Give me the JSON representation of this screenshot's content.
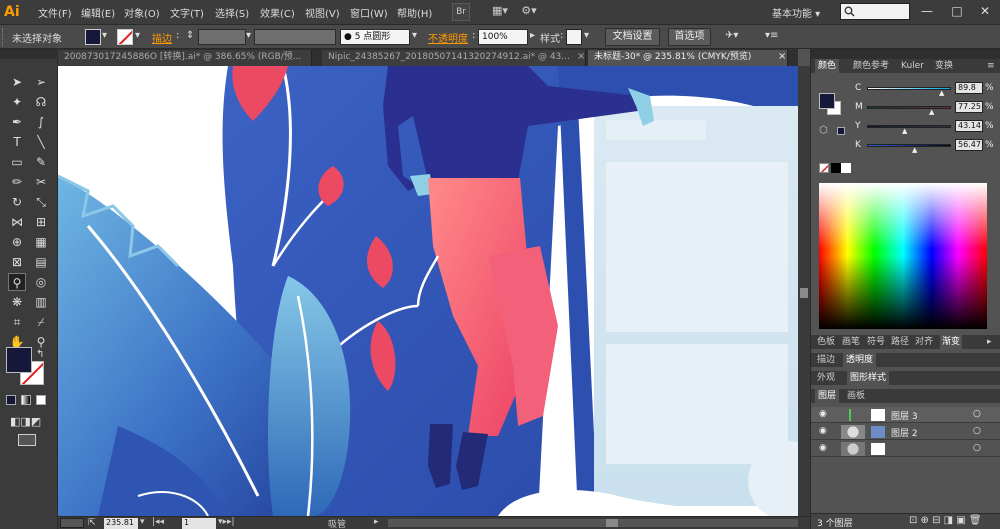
{
  "app": {
    "logo": "Ai",
    "workspace": "基本功能",
    "minimize": "—",
    "restore": "□",
    "close": "✕"
  },
  "menus": [
    "文件(F)",
    "编辑(E)",
    "对象(O)",
    "文字(T)",
    "选择(S)",
    "效果(C)",
    "视图(V)",
    "窗口(W)",
    "帮助(H)"
  ],
  "menubar_icons": [
    "Br",
    "▦▾",
    "⚙▾"
  ],
  "control": {
    "selection": "未选择对象",
    "stroke_label": "描边",
    "brush": "● 5 点圆形",
    "opacity_label": "不透明度",
    "opacity_value": "100%",
    "style_label": "样式",
    "doc_setup": "文档设置",
    "prefs": "首选项"
  },
  "tabs": [
    "200873017245886O [转换].ai* @ 386.65% (RGB/预...",
    "Nipic_24385267_20180507141320274912.ai* @ 43...",
    "未标题-30* @ 235.81% (CMYK/预览)"
  ],
  "tab_close": "×",
  "status": {
    "zoom": "235.81",
    "page": "1",
    "tool": "吸管"
  },
  "color_panel": {
    "tabs": [
      "颜色",
      "颜色参考",
      "Kuler",
      "变换"
    ],
    "channels": [
      {
        "name": "C",
        "value": "89.8",
        "pos": 0.9
      },
      {
        "name": "M",
        "value": "77.25",
        "pos": 0.77
      },
      {
        "name": "Y",
        "value": "43.14",
        "pos": 0.43
      },
      {
        "name": "K",
        "value": "56.47",
        "pos": 0.56
      }
    ],
    "fill_color": "#151838"
  },
  "panel_tabs_1": [
    "色板",
    "画笔",
    "符号",
    "路径",
    "对齐",
    "渐变"
  ],
  "panel_tabs_2": [
    "描边",
    "透明度"
  ],
  "panel_tabs_3": [
    "外观",
    "图形样式"
  ],
  "panel_tabs_4": [
    "图层",
    "画板"
  ],
  "layers": [
    {
      "name": "图层 3",
      "color": "#4fc94f"
    },
    {
      "name": "图层 2",
      "color": "#ff3333"
    },
    {
      "name": "",
      "color": "#3a6cff"
    }
  ],
  "layer_count": "3 个图层",
  "colors": {
    "accent": "#ff9a00"
  }
}
